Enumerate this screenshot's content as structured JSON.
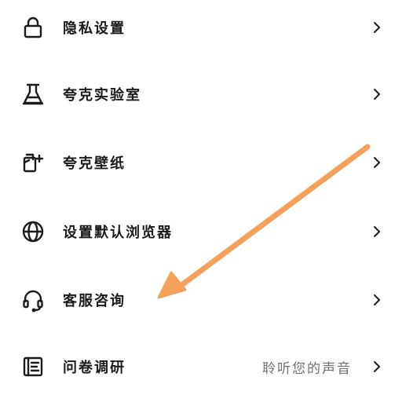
{
  "menu": {
    "items": [
      {
        "label": "隐私设置",
        "icon": "lock-icon"
      },
      {
        "label": "夸克实验室",
        "icon": "flask-icon"
      },
      {
        "label": "夸克壁纸",
        "icon": "wallpaper-icon"
      },
      {
        "label": "设置默认浏览器",
        "icon": "globe-icon"
      },
      {
        "label": "客服咨询",
        "icon": "headset-icon"
      },
      {
        "label": "问卷调研",
        "icon": "survey-icon",
        "hint": "聆听您的声音"
      }
    ]
  },
  "annotation": {
    "arrow_color": "#f5a15a"
  },
  "colors": {
    "text": "#1b1b1b",
    "hint": "#6f6f6f",
    "icon": "#1b1b1b"
  }
}
